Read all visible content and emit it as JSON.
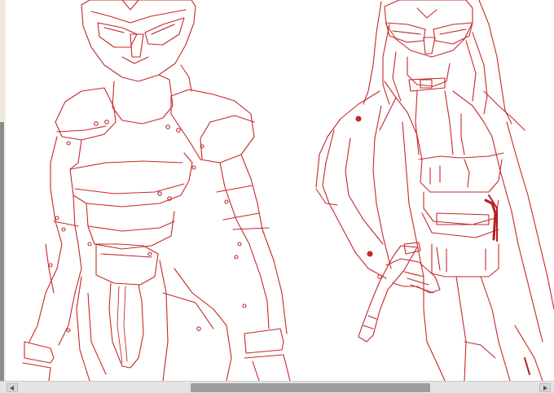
{
  "colors": {
    "line": "#c62828",
    "line_dark": "#b71c1c",
    "scrollbar_track": "#e4e4e4",
    "scrollbar_thumb": "#9d9d9d"
  },
  "icons": {
    "scroll_left": "triangle-left-icon",
    "scroll_right": "triangle-right-icon"
  },
  "horizontal_scroll": {
    "thumb_fraction_start": 0.34,
    "thumb_fraction_size": 0.43
  },
  "vertical_scroll": {
    "thumb_fraction_start": 0.31,
    "thumb_fraction_size": 0.66
  }
}
